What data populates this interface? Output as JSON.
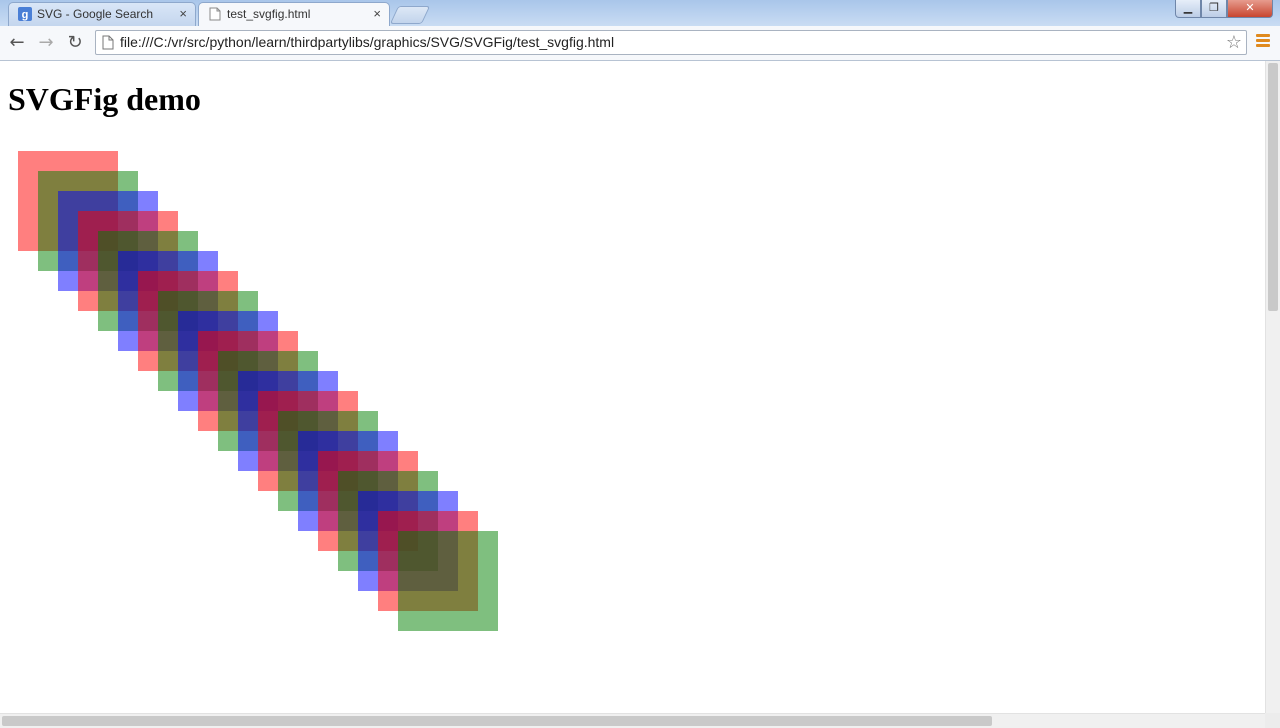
{
  "browser": {
    "tabs": [
      {
        "title": "SVG - Google Search",
        "favicon": "google-g-icon",
        "active": false
      },
      {
        "title": "test_svgfig.html",
        "favicon": "page-icon",
        "active": true
      }
    ],
    "close_glyph": "×",
    "url": "file:///C:/vr/src/python/learn/thirdpartylibs/graphics/SVG/SVGFig/test_svgfig.html",
    "nav": {
      "back": "←",
      "forward": "→",
      "reload": "↻"
    },
    "star": "☆",
    "window_buttons": {
      "minimize": "▁",
      "maximize": "❐",
      "close": "✕"
    }
  },
  "page": {
    "heading": "SVGFig demo",
    "figure": {
      "colors": [
        "#ff0000",
        "#008000",
        "#0000ff"
      ],
      "opacity": 0.5,
      "square_count": 20
    }
  }
}
